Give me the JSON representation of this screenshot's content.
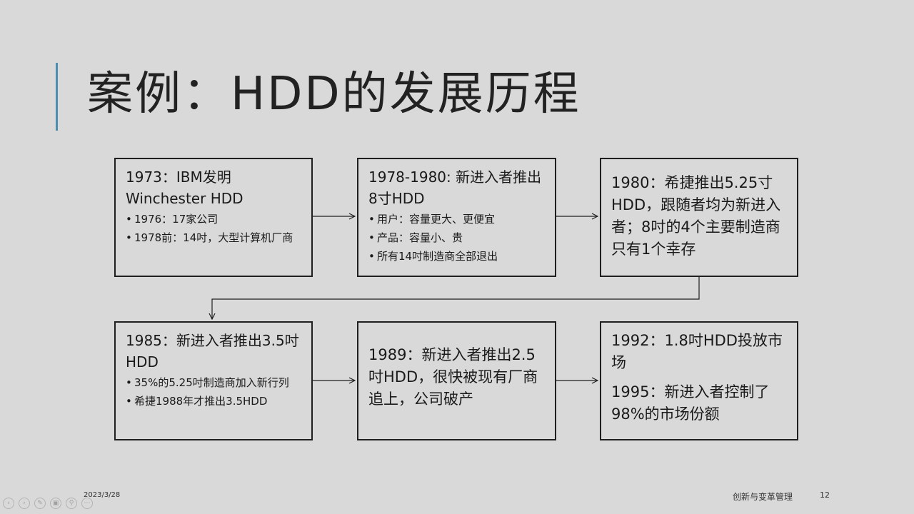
{
  "slide": {
    "title": "案例：HDD的发展历程",
    "boxes": [
      {
        "heading": "1973：IBM发明Winchester HDD",
        "bullets": [
          "1976：17家公司",
          "1978前：14吋，大型计算机厂商"
        ]
      },
      {
        "heading": "1978-1980: 新进入者推出8寸HDD",
        "bullets": [
          "用户：容量更大、更便宜",
          "产品：容量小、贵",
          "所有14吋制造商全部退出"
        ]
      },
      {
        "heading": "1980：希捷推出5.25寸HDD，跟随者均为新进入者；8吋的4个主要制造商只有1个幸存"
      },
      {
        "heading": "1985：新进入者推出3.5吋HDD",
        "bullets": [
          "35%的5.25吋制造商加入新行列",
          "希捷1988年才推出3.5HDD"
        ]
      },
      {
        "heading": "1989：新进入者推出2.5吋HDD，很快被现有厂商追上，公司破产"
      },
      {
        "heading": "1992：1.8吋HDD投放市场",
        "heading2": "1995：新进入者控制了98%的市场份额"
      }
    ]
  },
  "footer": {
    "date": "2023/3/28",
    "course": "创新与变革管理",
    "page": "12"
  },
  "controls": [
    "prev-icon",
    "next-icon",
    "pen-icon",
    "slides-icon",
    "zoom-icon",
    "more-icon"
  ]
}
